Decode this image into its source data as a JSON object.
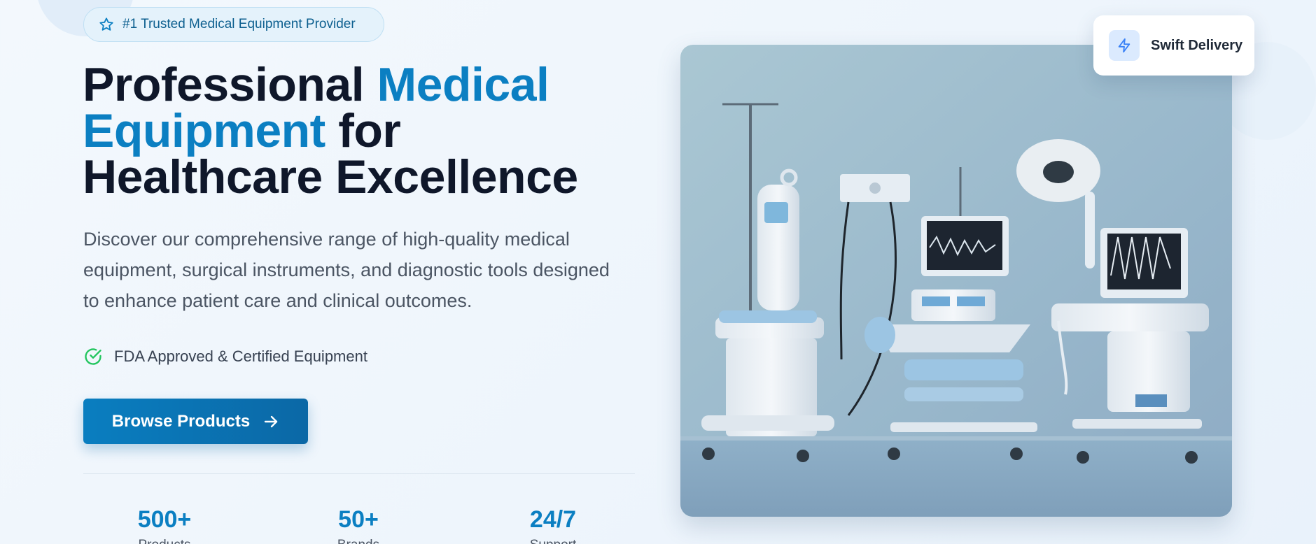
{
  "badge": {
    "icon": "star-icon",
    "text": "#1 Trusted Medical Equipment Provider"
  },
  "hero": {
    "title_part1": "Professional ",
    "title_accent1": "Medical Equipment",
    "title_part2": " for Healthcare Excellence",
    "description": "Discover our comprehensive range of high-quality medical equipment, surgical instruments, and diagnostic tools designed to enhance patient care and clinical outcomes.",
    "feature": {
      "icon": "check-circle-icon",
      "text": "FDA Approved & Certified Equipment"
    },
    "cta": {
      "label": "Browse Products",
      "icon": "arrow-right-icon"
    }
  },
  "stats": [
    {
      "value": "500+",
      "label": "Products"
    },
    {
      "value": "50+",
      "label": "Brands"
    },
    {
      "value": "24/7",
      "label": "Support"
    }
  ],
  "delivery_card": {
    "icon": "lightning-icon",
    "label": "Swift Delivery"
  },
  "colors": {
    "accent": "#0b7fc2",
    "dark_text": "#0f172a",
    "success": "#22c55e"
  }
}
